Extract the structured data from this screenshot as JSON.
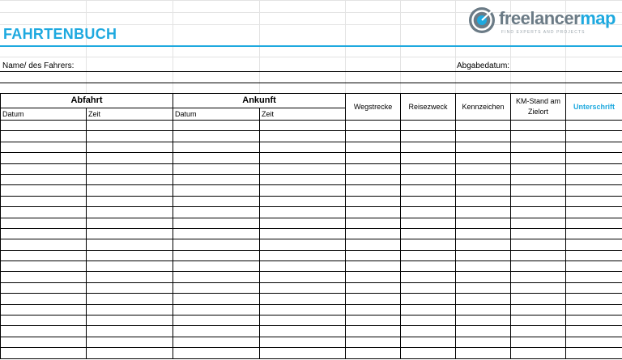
{
  "document": {
    "title": "FAHRTENBUCH",
    "brand": {
      "name_part1": "freelancer",
      "name_part2": "map",
      "tagline": "FIND EXPERTS AND PROJECTS",
      "logo_icon": "freelancermap-logo-icon",
      "color": "#1ea9df"
    },
    "fields": {
      "driver_label": "Name/ des Fahrers:",
      "date_label": "Abgabedatum:"
    }
  },
  "table": {
    "groups": {
      "departure": "Abfahrt",
      "arrival": "Ankunft"
    },
    "sub": {
      "dep_date": "Datum",
      "dep_time": "Zeit",
      "arr_date": "Datum",
      "arr_time": "Zeit"
    },
    "columns": {
      "distance": "Wegstrecke",
      "purpose": "Reisezweck",
      "plate": "Kennzeichen",
      "odometer": "KM-Stand am Zielort",
      "signature": "Unterschrift"
    },
    "empty_rows": 22
  }
}
